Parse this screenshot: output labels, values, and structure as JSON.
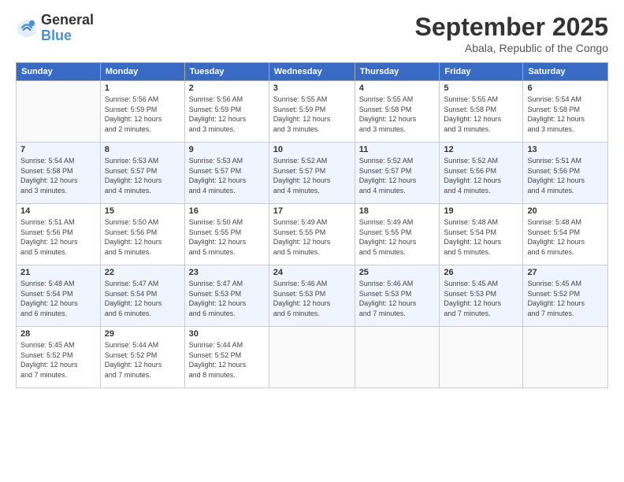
{
  "header": {
    "logo_general": "General",
    "logo_blue": "Blue",
    "month_title": "September 2025",
    "subtitle": "Abala, Republic of the Congo"
  },
  "days_of_week": [
    "Sunday",
    "Monday",
    "Tuesday",
    "Wednesday",
    "Thursday",
    "Friday",
    "Saturday"
  ],
  "weeks": [
    [
      {
        "day": "",
        "info": ""
      },
      {
        "day": "1",
        "info": "Sunrise: 5:56 AM\nSunset: 5:59 PM\nDaylight: 12 hours\nand 2 minutes."
      },
      {
        "day": "2",
        "info": "Sunrise: 5:56 AM\nSunset: 5:59 PM\nDaylight: 12 hours\nand 3 minutes."
      },
      {
        "day": "3",
        "info": "Sunrise: 5:55 AM\nSunset: 5:59 PM\nDaylight: 12 hours\nand 3 minutes."
      },
      {
        "day": "4",
        "info": "Sunrise: 5:55 AM\nSunset: 5:58 PM\nDaylight: 12 hours\nand 3 minutes."
      },
      {
        "day": "5",
        "info": "Sunrise: 5:55 AM\nSunset: 5:58 PM\nDaylight: 12 hours\nand 3 minutes."
      },
      {
        "day": "6",
        "info": "Sunrise: 5:54 AM\nSunset: 5:58 PM\nDaylight: 12 hours\nand 3 minutes."
      }
    ],
    [
      {
        "day": "7",
        "info": "Sunrise: 5:54 AM\nSunset: 5:58 PM\nDaylight: 12 hours\nand 3 minutes."
      },
      {
        "day": "8",
        "info": "Sunrise: 5:53 AM\nSunset: 5:57 PM\nDaylight: 12 hours\nand 4 minutes."
      },
      {
        "day": "9",
        "info": "Sunrise: 5:53 AM\nSunset: 5:57 PM\nDaylight: 12 hours\nand 4 minutes."
      },
      {
        "day": "10",
        "info": "Sunrise: 5:52 AM\nSunset: 5:57 PM\nDaylight: 12 hours\nand 4 minutes."
      },
      {
        "day": "11",
        "info": "Sunrise: 5:52 AM\nSunset: 5:57 PM\nDaylight: 12 hours\nand 4 minutes."
      },
      {
        "day": "12",
        "info": "Sunrise: 5:52 AM\nSunset: 5:56 PM\nDaylight: 12 hours\nand 4 minutes."
      },
      {
        "day": "13",
        "info": "Sunrise: 5:51 AM\nSunset: 5:56 PM\nDaylight: 12 hours\nand 4 minutes."
      }
    ],
    [
      {
        "day": "14",
        "info": "Sunrise: 5:51 AM\nSunset: 5:56 PM\nDaylight: 12 hours\nand 5 minutes."
      },
      {
        "day": "15",
        "info": "Sunrise: 5:50 AM\nSunset: 5:56 PM\nDaylight: 12 hours\nand 5 minutes."
      },
      {
        "day": "16",
        "info": "Sunrise: 5:50 AM\nSunset: 5:55 PM\nDaylight: 12 hours\nand 5 minutes."
      },
      {
        "day": "17",
        "info": "Sunrise: 5:49 AM\nSunset: 5:55 PM\nDaylight: 12 hours\nand 5 minutes."
      },
      {
        "day": "18",
        "info": "Sunrise: 5:49 AM\nSunset: 5:55 PM\nDaylight: 12 hours\nand 5 minutes."
      },
      {
        "day": "19",
        "info": "Sunrise: 5:48 AM\nSunset: 5:54 PM\nDaylight: 12 hours\nand 5 minutes."
      },
      {
        "day": "20",
        "info": "Sunrise: 5:48 AM\nSunset: 5:54 PM\nDaylight: 12 hours\nand 6 minutes."
      }
    ],
    [
      {
        "day": "21",
        "info": "Sunrise: 5:48 AM\nSunset: 5:54 PM\nDaylight: 12 hours\nand 6 minutes."
      },
      {
        "day": "22",
        "info": "Sunrise: 5:47 AM\nSunset: 5:54 PM\nDaylight: 12 hours\nand 6 minutes."
      },
      {
        "day": "23",
        "info": "Sunrise: 5:47 AM\nSunset: 5:53 PM\nDaylight: 12 hours\nand 6 minutes."
      },
      {
        "day": "24",
        "info": "Sunrise: 5:46 AM\nSunset: 5:53 PM\nDaylight: 12 hours\nand 6 minutes."
      },
      {
        "day": "25",
        "info": "Sunrise: 5:46 AM\nSunset: 5:53 PM\nDaylight: 12 hours\nand 7 minutes."
      },
      {
        "day": "26",
        "info": "Sunrise: 5:45 AM\nSunset: 5:53 PM\nDaylight: 12 hours\nand 7 minutes."
      },
      {
        "day": "27",
        "info": "Sunrise: 5:45 AM\nSunset: 5:52 PM\nDaylight: 12 hours\nand 7 minutes."
      }
    ],
    [
      {
        "day": "28",
        "info": "Sunrise: 5:45 AM\nSunset: 5:52 PM\nDaylight: 12 hours\nand 7 minutes."
      },
      {
        "day": "29",
        "info": "Sunrise: 5:44 AM\nSunset: 5:52 PM\nDaylight: 12 hours\nand 7 minutes."
      },
      {
        "day": "30",
        "info": "Sunrise: 5:44 AM\nSunset: 5:52 PM\nDaylight: 12 hours\nand 8 minutes."
      },
      {
        "day": "",
        "info": ""
      },
      {
        "day": "",
        "info": ""
      },
      {
        "day": "",
        "info": ""
      },
      {
        "day": "",
        "info": ""
      }
    ]
  ]
}
